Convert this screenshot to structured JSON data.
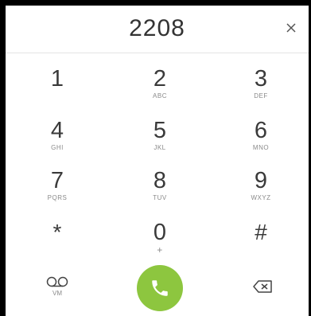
{
  "display": {
    "number": "2208"
  },
  "keypad": {
    "keys": [
      {
        "digit": "1",
        "letters": ""
      },
      {
        "digit": "2",
        "letters": "ABC"
      },
      {
        "digit": "3",
        "letters": "DEF"
      },
      {
        "digit": "4",
        "letters": "GHI"
      },
      {
        "digit": "5",
        "letters": "JKL"
      },
      {
        "digit": "6",
        "letters": "MNO"
      },
      {
        "digit": "7",
        "letters": "PQRS"
      },
      {
        "digit": "8",
        "letters": "TUV"
      },
      {
        "digit": "9",
        "letters": "WXYZ"
      },
      {
        "digit": "*",
        "letters": ""
      },
      {
        "digit": "0",
        "letters": "+"
      },
      {
        "digit": "#",
        "letters": ""
      }
    ]
  },
  "actions": {
    "voicemail_label": "VM"
  },
  "colors": {
    "call_button": "#8dc63f",
    "digit_text": "#3a3a3a",
    "letter_text": "#8a8a8a",
    "background": "#ffffff"
  },
  "icons": {
    "clear": "close-icon",
    "voicemail": "voicemail-icon",
    "call": "phone-icon",
    "backspace": "backspace-icon"
  }
}
